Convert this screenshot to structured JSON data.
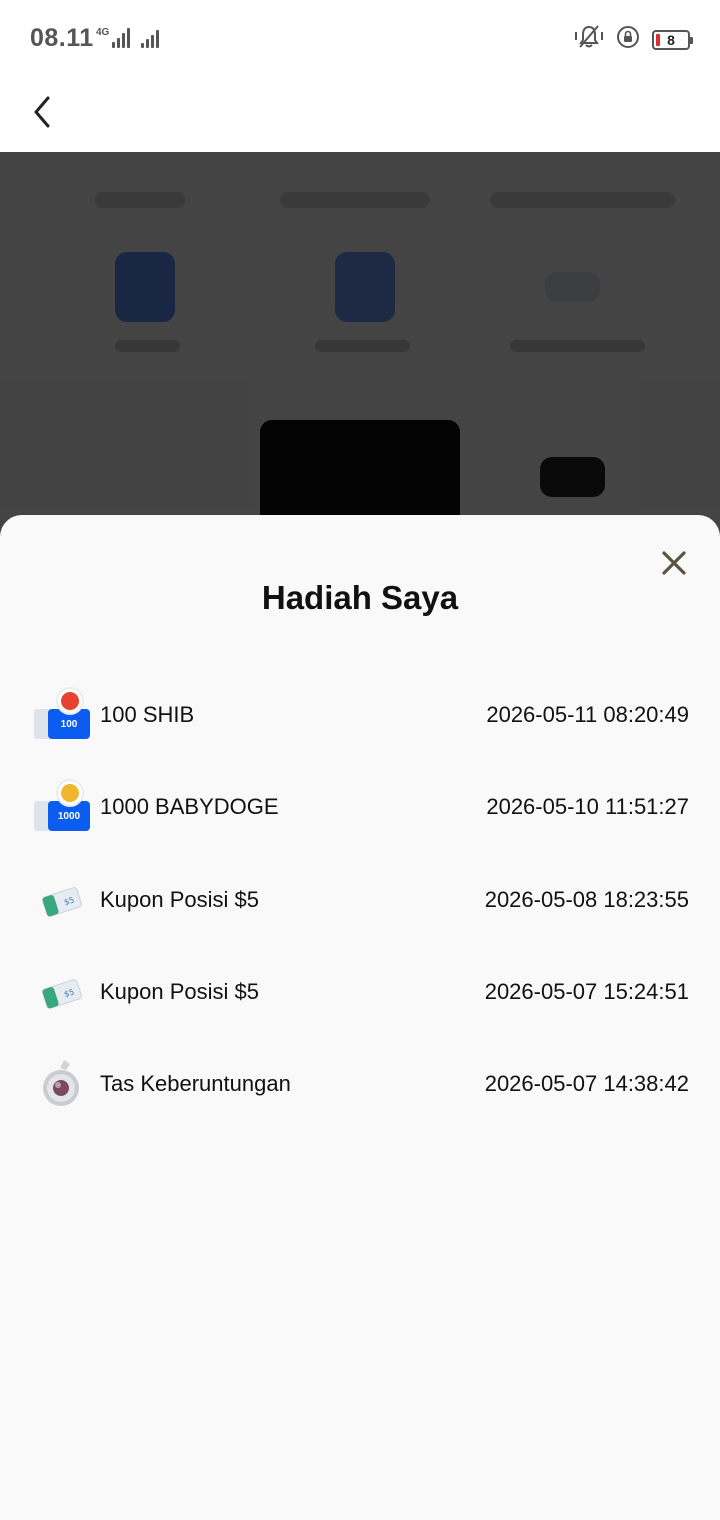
{
  "status_bar": {
    "time": "08.11",
    "network": "4G",
    "battery": "8"
  },
  "header": {
    "back_icon": "chevron-left-icon"
  },
  "sheet": {
    "title": "Hadiah Saya",
    "close_icon": "close-icon",
    "rewards": [
      {
        "icon": "shib-token-icon",
        "icon_text": "100",
        "name": "100 SHIB",
        "date": "2026-05-11 08:20:49"
      },
      {
        "icon": "babydoge-token-icon",
        "icon_text": "1000",
        "name": "1000 BABYDOGE",
        "date": "2026-05-10 11:51:27"
      },
      {
        "icon": "coupon-icon",
        "name": "Kupon Posisi $5",
        "date": "2026-05-08 18:23:55"
      },
      {
        "icon": "coupon-icon",
        "name": "Kupon Posisi $5",
        "date": "2026-05-07 15:24:51"
      },
      {
        "icon": "lucky-bag-icon",
        "name": "Tas Keberuntungan",
        "date": "2026-05-07 14:38:42"
      }
    ]
  },
  "colors": {
    "token_blue": "#0b5cf0",
    "close_icon": "#5b5340",
    "sheet_background": "#f9f9f9"
  }
}
